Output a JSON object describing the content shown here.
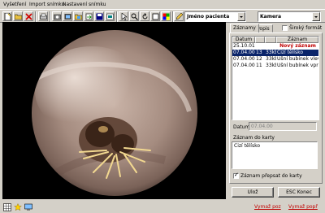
{
  "menu": [
    "Vyšetření",
    "Import snímku",
    "Nastavení snímku"
  ],
  "toolbar": {
    "patient_combo": "Jméno pacienta",
    "camera_combo": "Kamera"
  },
  "tabs": [
    "Záznamy",
    "Popis"
  ],
  "wide_format_label": "Široký formát",
  "records": {
    "columns": [
      "Datum",
      "",
      "",
      "Záznam"
    ],
    "rows": [
      {
        "date": "25.10.01",
        "num": "",
        "size": "",
        "text": "Nový záznam",
        "style": "new"
      },
      {
        "date": "07.04.00",
        "num": "13",
        "size": "33kb",
        "text": "Cizí tělísko",
        "style": "selected"
      },
      {
        "date": "07.04.00",
        "num": "12",
        "size": "33kb",
        "text": "Ušní bubínek vlevo",
        "style": ""
      },
      {
        "date": "07.04.00",
        "num": "11",
        "size": "33kb",
        "text": "Ušní bubínek vpravo",
        "style": ""
      }
    ]
  },
  "date_label": "Datum:",
  "date_value": "07.04.00",
  "card_label": "Záznam do karty",
  "card_text": "Cizí tělísko",
  "overwrite_label": "Záznam přepsat do karty",
  "buttons": {
    "save": "Ulož",
    "exit": "ESC Konec"
  },
  "status": {
    "delete_pos": "Vymaž poz",
    "delete_all": "Vymaž popř"
  },
  "colors": {
    "new_record": "#c00000",
    "selection": "#0a246a",
    "window": "#d4d0c8"
  }
}
